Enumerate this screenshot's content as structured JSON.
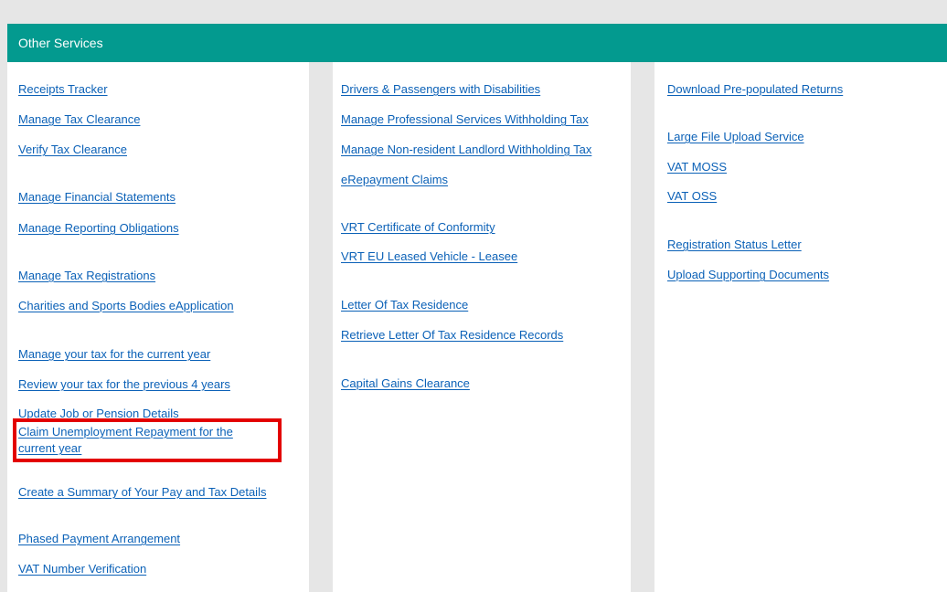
{
  "header": {
    "title": "Other Services"
  },
  "columns": {
    "col1": {
      "items": [
        "Receipts Tracker",
        "Manage Tax Clearance",
        "Verify Tax Clearance",
        "Manage Financial Statements",
        "Manage Reporting Obligations",
        "Manage Tax Registrations",
        "Charities and Sports Bodies eApplication",
        "Manage your tax for the current year",
        "Review your tax for the previous 4 years",
        "Update Job or Pension Details",
        "Claim Unemployment Repayment for the current year",
        "Create a Summary of Your Pay and Tax Details",
        "Phased Payment Arrangement",
        "VAT Number Verification"
      ]
    },
    "col2": {
      "items": [
        "Drivers & Passengers with Disabilities",
        "Manage Professional Services Withholding Tax",
        "Manage Non-resident Landlord Withholding Tax",
        "eRepayment Claims",
        "VRT Certificate of Conformity",
        "VRT EU Leased Vehicle - Leasee",
        "Letter Of Tax Residence",
        "Retrieve Letter Of Tax Residence Records",
        "Capital Gains Clearance"
      ]
    },
    "col3": {
      "items": [
        "Download Pre-populated Returns",
        "Large File Upload Service",
        "VAT MOSS",
        "VAT OSS",
        "Registration Status Letter",
        "Upload Supporting Documents"
      ]
    }
  },
  "colors": {
    "header_bg": "#039a8f",
    "link": "#0b61b7",
    "highlight": "#e30000"
  }
}
